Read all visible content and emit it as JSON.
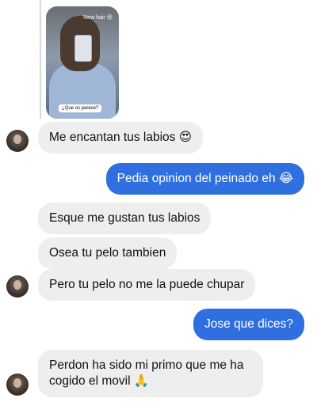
{
  "story": {
    "caption_top": "New hair 😍",
    "caption_bottom": "¿Que os parece?"
  },
  "messages": [
    {
      "side": "in",
      "text": "Me encantan tus labios 😍"
    },
    {
      "side": "out",
      "text": "Pedia opinion del peinado eh 😂"
    },
    {
      "side": "in",
      "text": "Esque me gustan tus labios"
    },
    {
      "side": "in",
      "text": "Osea tu pelo tambien"
    },
    {
      "side": "in",
      "text": "Pero tu pelo no me la puede chupar"
    },
    {
      "side": "out",
      "text": "Jose que dices?"
    },
    {
      "side": "in",
      "text": "Perdon ha sido mi primo que me ha cogido el movil 🙏"
    }
  ],
  "colors": {
    "outgoing": "#2f6fe0",
    "incoming": "#eeeeef"
  }
}
